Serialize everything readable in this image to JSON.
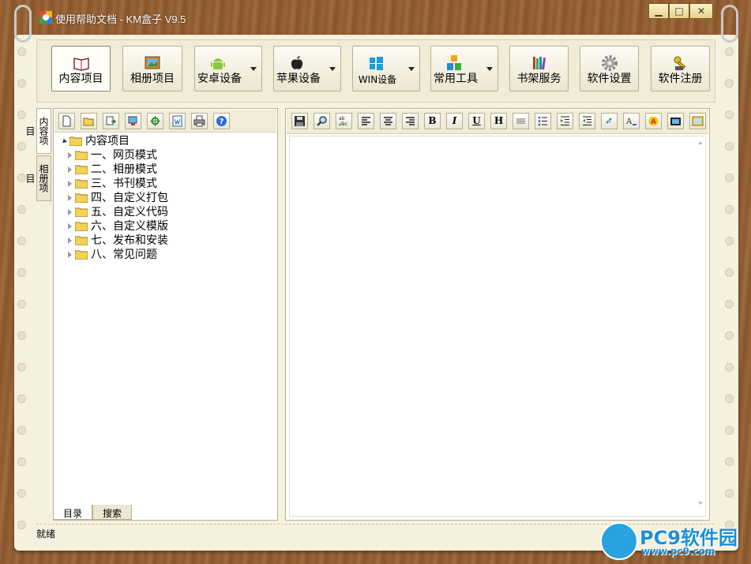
{
  "window": {
    "title": "使用帮助文档 - KM盒子 V9.5",
    "minimize_glyph": "▁",
    "maximize_glyph": "□",
    "close_glyph": "✕"
  },
  "toolbar": {
    "buttons": [
      {
        "label": "内容项目",
        "icon": "book-icon",
        "active": true
      },
      {
        "label": "相册项目",
        "icon": "photo-frame-icon"
      },
      {
        "label": "安卓设备",
        "icon": "android-icon",
        "dropdown": true
      },
      {
        "label": "苹果设备",
        "icon": "apple-icon",
        "dropdown": true
      },
      {
        "label": "WIN设备",
        "icon": "windows-icon",
        "dropdown": true
      },
      {
        "label": "常用工具",
        "icon": "tools-blocks-icon",
        "dropdown": true
      },
      {
        "label": "书架服务",
        "icon": "bookshelf-icon"
      },
      {
        "label": "软件设置",
        "icon": "gear-icon"
      },
      {
        "label": "软件注册",
        "icon": "key-icon"
      }
    ]
  },
  "side_tabs": [
    "内容项目",
    "相册项目"
  ],
  "left_toolbar": [
    "new-file-icon",
    "open-folder-icon",
    "import-icon",
    "export-icon",
    "locate-icon",
    "word-icon",
    "print-icon",
    "help-icon"
  ],
  "tree": {
    "root": "内容项目",
    "items": [
      "一、网页模式",
      "二、相册模式",
      "三、书刊模式",
      "四、自定义打包",
      "五、自定义代码",
      "六、自定义模版",
      "七、发布和安装",
      "八、常见问题"
    ]
  },
  "bottom_tabs": [
    "目录",
    "搜索"
  ],
  "editor_toolbar": {
    "bold": "B",
    "italic": "I",
    "underline": "U",
    "heading": "H",
    "spell_label": "ab ac"
  },
  "status": {
    "text": "就绪"
  },
  "watermark": {
    "brand": "PC9软件园",
    "url": "www.pc9.com"
  },
  "colors": {
    "accent": "#1e8fd6",
    "paper": "#f5f1df",
    "wood": "#8b5a30"
  }
}
